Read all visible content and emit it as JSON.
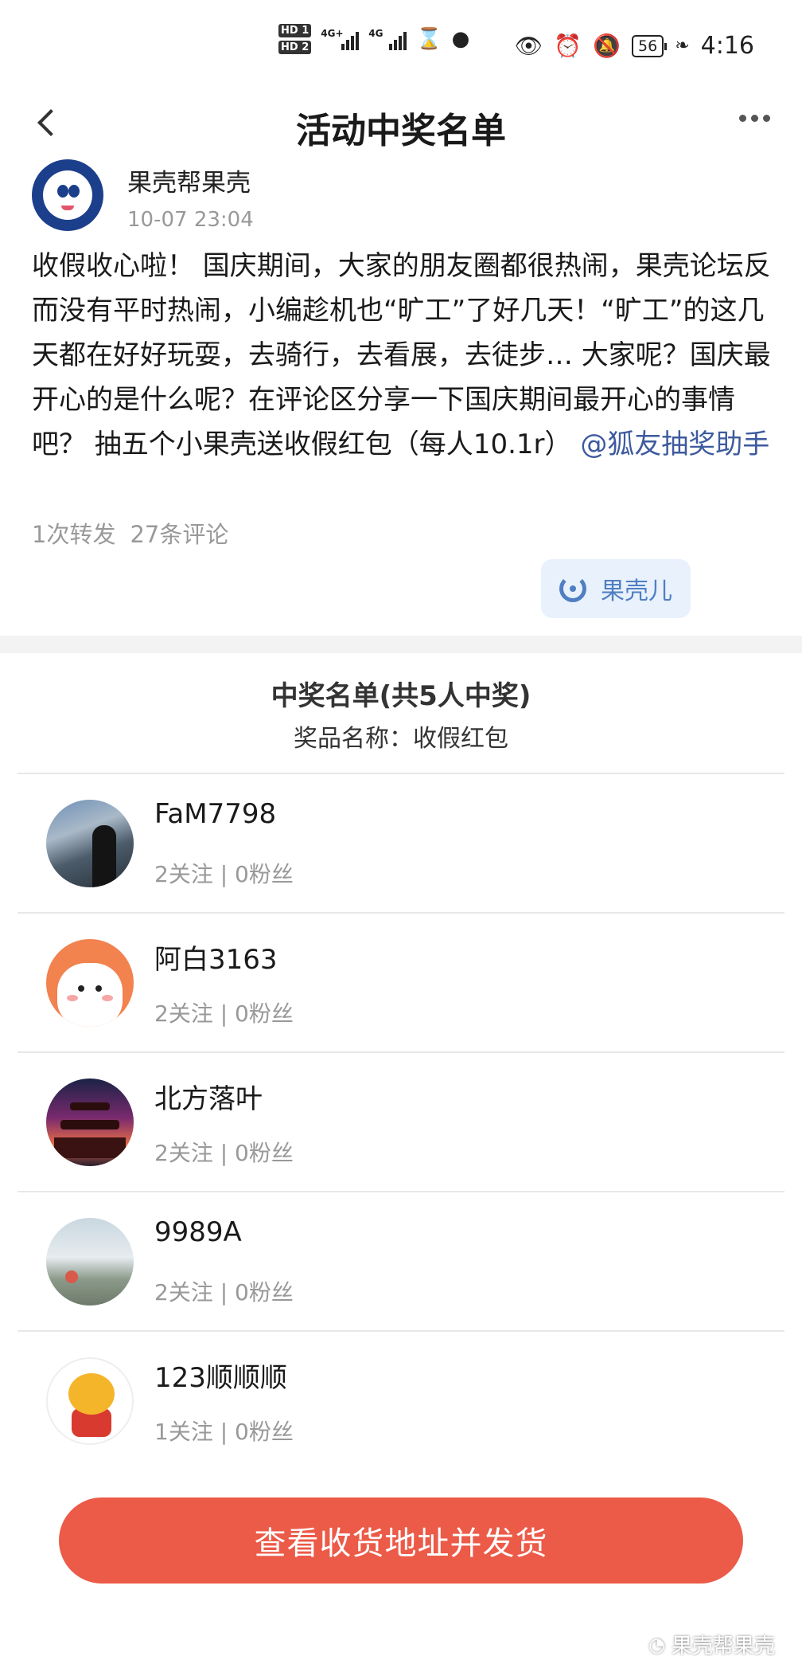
{
  "status_bar": {
    "hd1": "HD 1",
    "hd2": "HD 2",
    "sig1_gen": "4G+",
    "sig2_gen": "4G",
    "battery": "56",
    "time": "4:16"
  },
  "nav": {
    "title": "活动中奖名单"
  },
  "post": {
    "author": "果壳帮果壳",
    "time": "10-07 23:04",
    "body_text": "收假收心啦！ 国庆期间，大家的朋友圈都很热闹，果壳论坛反而没有平时热闹，小编趁机也“旷工”了好几天！“旷工”的这几天都在好好玩耍，去骑行，去看展，去徒步… 大家呢？国庆最开心的是什么呢？在评论区分享一下国庆期间最开心的事情吧？ 抽五个小果壳送收假红包（每人10.1r）",
    "mention": "@狐友抽奖助手",
    "reposts": "1次转发",
    "comments": "27条评论",
    "react_label": "果壳儿"
  },
  "winners_section": {
    "title": "中奖名单(共5人中奖)",
    "prize": "奖品名称：收假红包",
    "winners": [
      {
        "name": "FaM7798",
        "stats": "2关注 | 0粉丝"
      },
      {
        "name": "阿白3163",
        "stats": "2关注 | 0粉丝"
      },
      {
        "name": "北方落叶",
        "stats": "2关注 | 0粉丝"
      },
      {
        "name": "9989A",
        "stats": "2关注 | 0粉丝"
      },
      {
        "name": "123顺顺顺",
        "stats": "1关注 | 0粉丝"
      }
    ]
  },
  "action_button": "查看收货地址并发货",
  "watermark": "果壳帮果壳",
  "colors": {
    "accent_button": "#ec5a48",
    "mention": "#3d5a9e",
    "react_bg": "#e8f1fc",
    "react_fg": "#4f7fc2"
  }
}
